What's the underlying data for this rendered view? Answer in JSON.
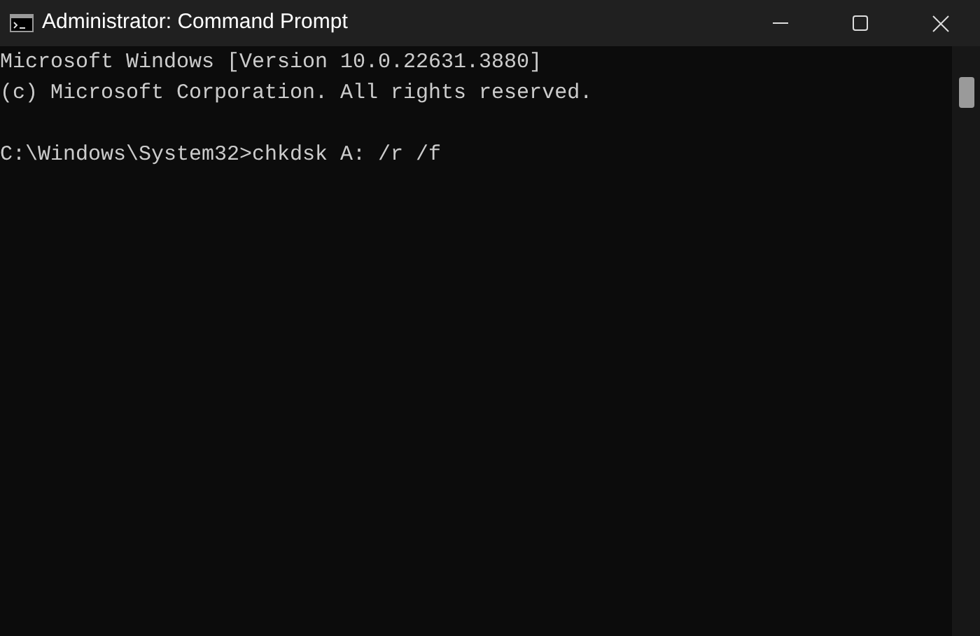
{
  "window": {
    "title": "Administrator: Command Prompt"
  },
  "console": {
    "blocks": [
      [
        "Microsoft Windows [Version 10.0.22631.3880]",
        "(c) Microsoft Corporation. All rights reserved."
      ],
      [
        "C:\\Windows\\System32>chkdsk A: /r /f"
      ]
    ]
  }
}
